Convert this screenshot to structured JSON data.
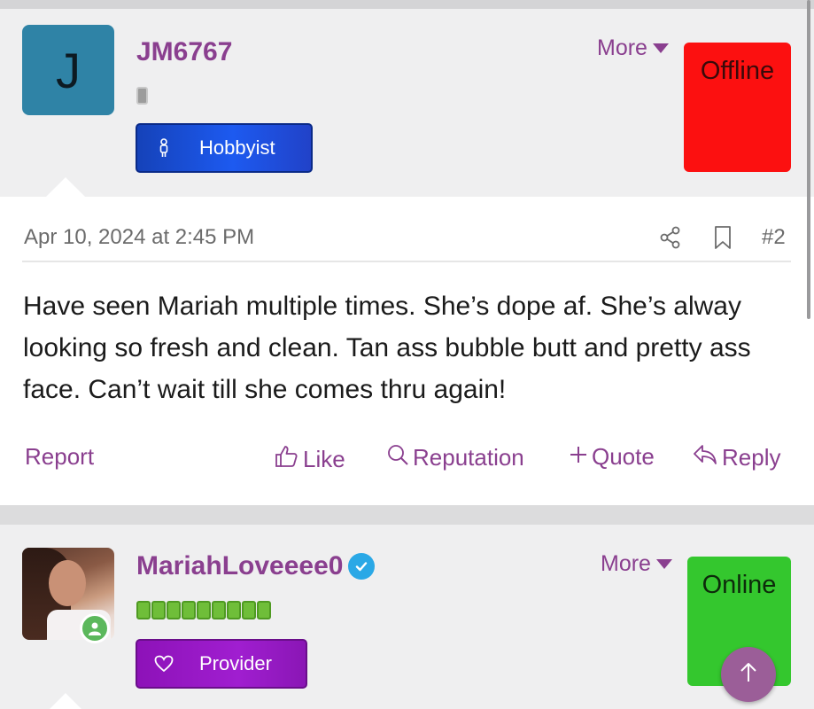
{
  "post1": {
    "avatar_letter": "J",
    "username": "JM6767",
    "badge_label": "Hobbyist",
    "more_label": "More",
    "status_label": "Offline",
    "date": "Apr 10, 2024 at 2:45 PM",
    "post_number": "#2",
    "body": "Have seen Mariah multiple times. She’s dope af. She’s alway looking so fresh and clean. Tan ass bubble butt and pretty ass face. Can’t wait till she comes thru again!",
    "actions": {
      "report": "Report",
      "like": "Like",
      "reputation": "Reputation",
      "quote": "Quote",
      "reply": "Reply"
    }
  },
  "post2": {
    "username": "MariahLoveeee0",
    "badge_label": "Provider",
    "more_label": "More",
    "status_label": "Online",
    "reputation_level": 9
  },
  "colors": {
    "accent": "#8a3f8f",
    "offline": "#fc1010",
    "online": "#34c72e",
    "hobbyist_badge": "#1d5af0",
    "provider_badge": "#a01ed0"
  },
  "icons": [
    "male-icon",
    "share-icon",
    "bookmark-icon",
    "thumbs-up-icon",
    "search-icon",
    "plus-icon",
    "reply-icon",
    "heart-icon",
    "verified-icon",
    "user-icon",
    "arrow-up-icon",
    "caret-down-icon"
  ]
}
